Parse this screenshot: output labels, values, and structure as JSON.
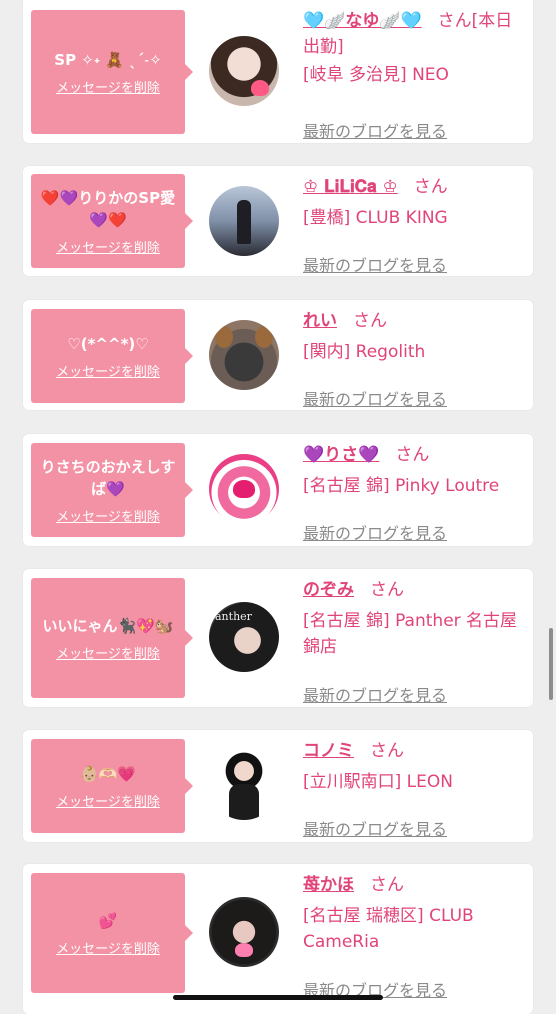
{
  "messages": [
    {
      "msg": "SP ✧˖ 🧸 ˎˊ˗✧",
      "del": "メッセージを削除",
      "name": "🩵🪽なゆ🪽🩵",
      "san": "さん",
      "shop": "[本日出勤]",
      "shop2": "[岐阜 多治見] NEO",
      "blog": "最新のブログを見る"
    },
    {
      "msg": "❤️💜りりかのSP愛💜❤️",
      "del": "メッセージを削除",
      "name": "♔ 𝐋𝐢𝐋𝐢𝐂𝐚 ♔",
      "san": "さん",
      "shop": "[豊橋] CLUB KING",
      "blog": "最新のブログを見る"
    },
    {
      "msg": "♡(*^^*)♡",
      "del": "メッセージを削除",
      "name": "れい",
      "san": "さん",
      "shop": "[関内] Regolith",
      "blog": "最新のブログを見る"
    },
    {
      "msg": "りさちのおかえしすば💜",
      "del": "メッセージを削除",
      "name": "💜りさ💜",
      "san": "さん",
      "shop": "[名古屋 錦] Pinky Loutre",
      "blog": "最新のブログを見る"
    },
    {
      "msg": "いいにゃん🐈‍⬛💖🐿️",
      "del": "メッセージを削除",
      "name": "のぞみ",
      "san": "さん",
      "shop": "[名古屋 錦] Panther 名古屋錦店",
      "blog": "最新のブログを見る"
    },
    {
      "msg": "👶🏼🫶🏻💗",
      "del": "メッセージを削除",
      "name": "コノミ",
      "san": "さん",
      "shop": "[立川駅南口] LEON",
      "blog": "最新のブログを見る"
    },
    {
      "msg": "💕",
      "del": "メッセージを削除",
      "name": "苺かほ",
      "san": "さん",
      "shop": "[名古屋 瑞穂区] CLUB CameRia",
      "blog": "最新のブログを見る"
    }
  ]
}
